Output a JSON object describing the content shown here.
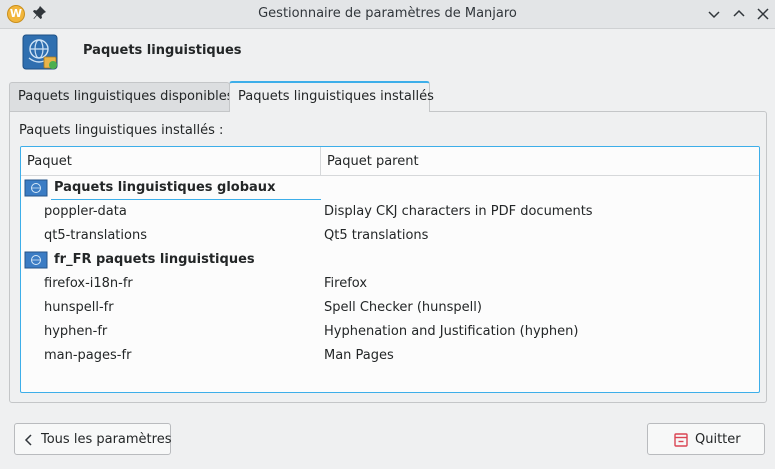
{
  "window": {
    "title": "Gestionnaire de paramètres de Manjaro",
    "app_icon": "manjaro-settings-icon",
    "app_icon_letter": "W"
  },
  "header": {
    "title": "Paquets linguistiques",
    "icon": "language-packages-icon"
  },
  "tabs": [
    {
      "label": "Paquets linguistiques disponibles",
      "active": false
    },
    {
      "label": "Paquets linguistiques installés",
      "active": true
    }
  ],
  "panel": {
    "label": "Paquets linguistiques installés :"
  },
  "tree": {
    "columns": [
      "Paquet",
      "Paquet parent"
    ],
    "groups": [
      {
        "label": "Paquets linguistiques globaux",
        "items": [
          {
            "name": "poppler-data",
            "parent": "Display CKJ characters in PDF documents"
          },
          {
            "name": "qt5-translations",
            "parent": "Qt5 translations"
          }
        ]
      },
      {
        "label": "fr_FR paquets linguistiques",
        "items": [
          {
            "name": "firefox-i18n-fr",
            "parent": "Firefox"
          },
          {
            "name": "hunspell-fr",
            "parent": "Spell Checker (hunspell)"
          },
          {
            "name": "hyphen-fr",
            "parent": "Hyphenation and Justification (hyphen)"
          },
          {
            "name": "man-pages-fr",
            "parent": "Man Pages"
          }
        ]
      }
    ]
  },
  "footer": {
    "back_label": "Tous les paramètres",
    "quit_label": "Quitter"
  },
  "colors": {
    "accent": "#3daee9",
    "quit_icon": "#da4453"
  }
}
